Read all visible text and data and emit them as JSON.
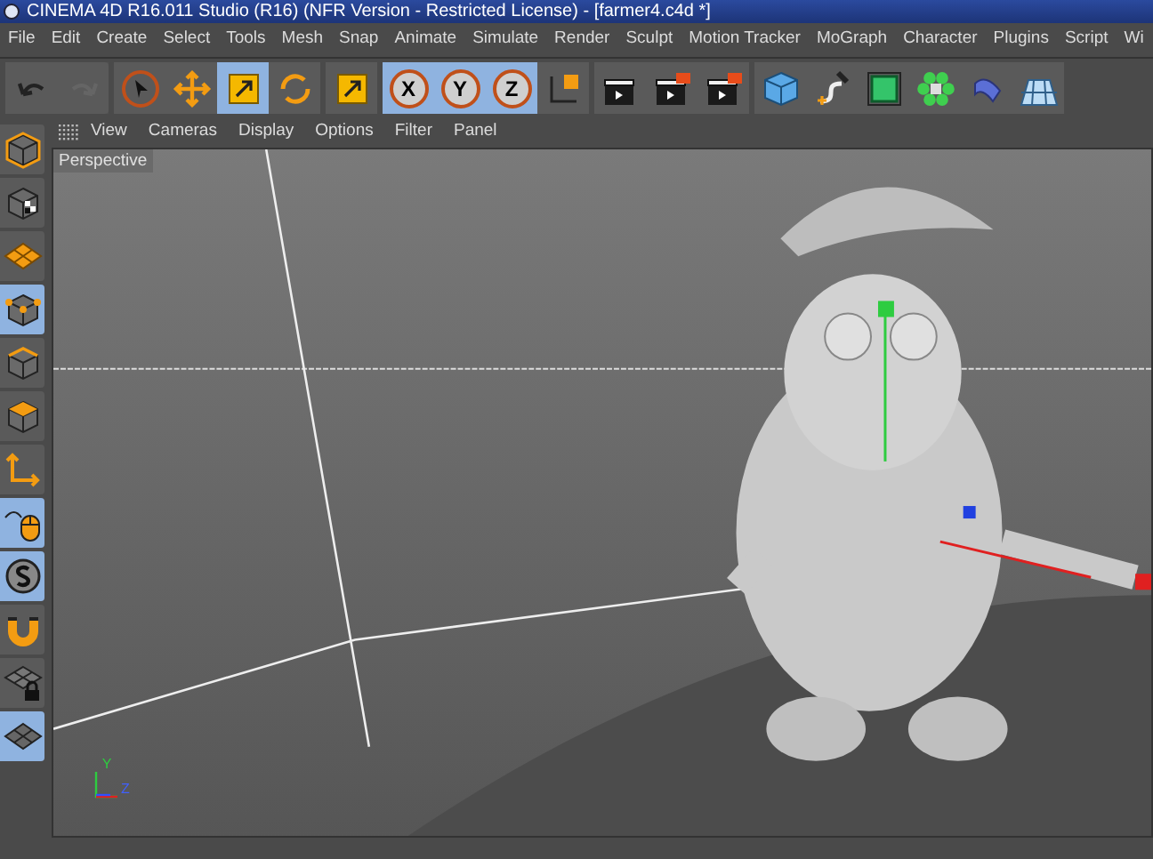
{
  "window": {
    "title": "CINEMA 4D R16.011 Studio (R16) (NFR Version - Restricted License) - [farmer4.c4d *]"
  },
  "menu": [
    "File",
    "Edit",
    "Create",
    "Select",
    "Tools",
    "Mesh",
    "Snap",
    "Animate",
    "Simulate",
    "Render",
    "Sculpt",
    "Motion Tracker",
    "MoGraph",
    "Character",
    "Plugins",
    "Script",
    "Wi"
  ],
  "toolbar": [
    {
      "kind": "undo",
      "selected": false,
      "disabled": false
    },
    {
      "kind": "redo",
      "selected": false,
      "disabled": true
    },
    {
      "kind": "select",
      "selected": false,
      "disabled": false
    },
    {
      "kind": "move",
      "selected": false,
      "disabled": false
    },
    {
      "kind": "scale",
      "selected": true,
      "disabled": false
    },
    {
      "kind": "rotate",
      "selected": false,
      "disabled": false
    },
    {
      "kind": "scale",
      "selected": false,
      "disabled": false
    },
    {
      "kind": "axis-lock",
      "label": "X",
      "selected": true,
      "disabled": false
    },
    {
      "kind": "axis-lock",
      "label": "Y",
      "selected": true,
      "disabled": false
    },
    {
      "kind": "axis-lock",
      "label": "Z",
      "selected": true,
      "disabled": false
    },
    {
      "kind": "coords",
      "selected": false,
      "disabled": false
    },
    {
      "kind": "render-view",
      "selected": false,
      "disabled": false
    },
    {
      "kind": "render",
      "selected": false,
      "disabled": false
    },
    {
      "kind": "render-settings",
      "selected": false,
      "disabled": false
    },
    {
      "kind": "cube",
      "selected": false,
      "disabled": false
    },
    {
      "kind": "spline",
      "selected": false,
      "disabled": false
    },
    {
      "kind": "nurbs",
      "selected": false,
      "disabled": false
    },
    {
      "kind": "array",
      "selected": false,
      "disabled": false
    },
    {
      "kind": "deformer",
      "selected": false,
      "disabled": false
    },
    {
      "kind": "floor",
      "selected": false,
      "disabled": false
    }
  ],
  "viewport": {
    "menu": [
      "View",
      "Cameras",
      "Display",
      "Options",
      "Filter",
      "Panel"
    ],
    "label": "Perspective",
    "axis_labels": [
      "Y",
      "Z"
    ]
  },
  "sidebar": [
    {
      "kind": "editable",
      "selected": false
    },
    {
      "kind": "texture",
      "selected": false
    },
    {
      "kind": "workplane",
      "selected": false
    },
    {
      "kind": "points",
      "selected": true
    },
    {
      "kind": "edges",
      "selected": false
    },
    {
      "kind": "polygons",
      "selected": false
    },
    {
      "kind": "axis",
      "selected": false
    },
    {
      "kind": "tweak",
      "selected": true
    },
    {
      "kind": "snap",
      "selected": true
    },
    {
      "kind": "magnet",
      "selected": false
    },
    {
      "kind": "lock",
      "selected": false
    },
    {
      "kind": "grid",
      "selected": true
    }
  ]
}
